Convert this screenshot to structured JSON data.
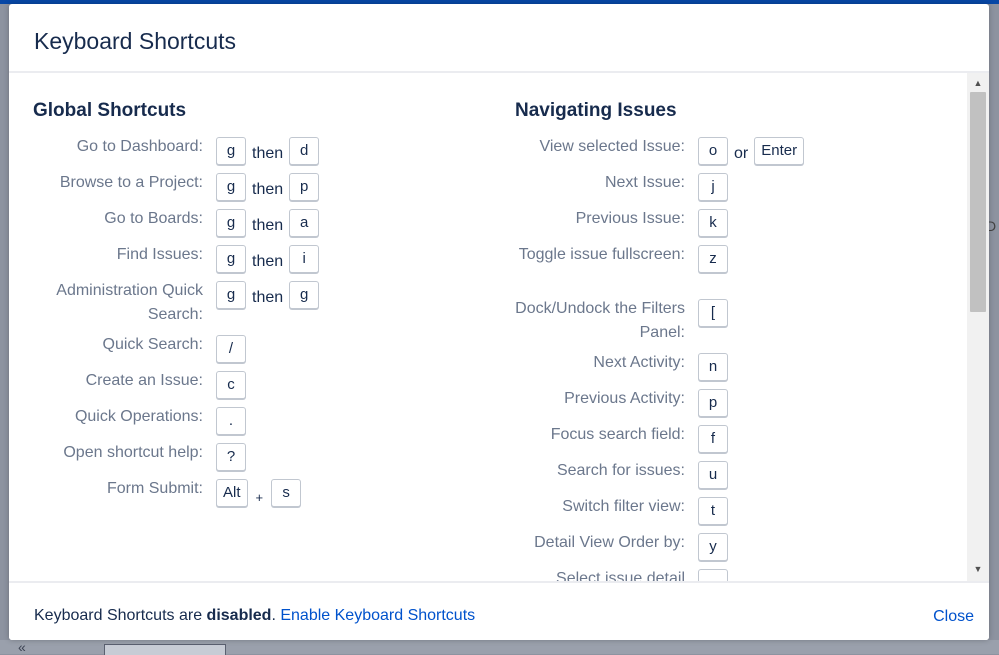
{
  "dialog": {
    "title": "Keyboard Shortcuts"
  },
  "global": {
    "heading": "Global Shortcuts",
    "items": [
      {
        "label": "Go to Dashboard:",
        "keys": [
          "g",
          "d"
        ],
        "sep": "then"
      },
      {
        "label": "Browse to a Project:",
        "keys": [
          "g",
          "p"
        ],
        "sep": "then"
      },
      {
        "label": "Go to Boards:",
        "keys": [
          "g",
          "a"
        ],
        "sep": "then"
      },
      {
        "label": "Find Issues:",
        "keys": [
          "g",
          "i"
        ],
        "sep": "then"
      },
      {
        "label": "Administration Quick Search:",
        "keys": [
          "g",
          "g"
        ],
        "sep": "then"
      },
      {
        "label": "Quick Search:",
        "keys": [
          "/"
        ]
      },
      {
        "label": "Create an Issue:",
        "keys": [
          "c"
        ]
      },
      {
        "label": "Quick Operations:",
        "keys": [
          "."
        ]
      },
      {
        "label": "Open shortcut help:",
        "keys": [
          "?"
        ]
      },
      {
        "label": "Form Submit:",
        "keys": [
          "Alt",
          "s"
        ],
        "sep": "+"
      }
    ]
  },
  "navigating": {
    "heading": "Navigating Issues",
    "items": [
      {
        "label": "View selected Issue:",
        "keys": [
          "o",
          "Enter"
        ],
        "sep": "or"
      },
      {
        "label": "Next Issue:",
        "keys": [
          "j"
        ]
      },
      {
        "label": "Previous Issue:",
        "keys": [
          "k"
        ]
      },
      {
        "label": "Toggle issue fullscreen:",
        "keys": [
          "z"
        ]
      },
      {
        "label": "Dock/Undock the Filters Panel:",
        "keys": [
          "["
        ]
      },
      {
        "label": "Next Activity:",
        "keys": [
          "n"
        ]
      },
      {
        "label": "Previous Activity:",
        "keys": [
          "p"
        ]
      },
      {
        "label": "Focus search field:",
        "keys": [
          "f"
        ]
      },
      {
        "label": "Search for issues:",
        "keys": [
          "u"
        ]
      },
      {
        "label": "Switch filter view:",
        "keys": [
          "t"
        ]
      },
      {
        "label": "Detail View Order by:",
        "keys": [
          "y"
        ]
      },
      {
        "label": "Select issue detail",
        "keys": [
          ","
        ]
      }
    ]
  },
  "footer": {
    "status_prefix": "Keyboard Shortcuts are ",
    "status_value": "disabled",
    "status_suffix": ".",
    "enable_link": "Enable Keyboard Shortcuts",
    "close_label": "Close"
  },
  "backdrop": {
    "chevron": "«",
    "edge_letter": "D"
  },
  "icons": {
    "scroll_up": "scroll-up-arrow-icon",
    "scroll_down": "scroll-down-arrow-icon"
  }
}
